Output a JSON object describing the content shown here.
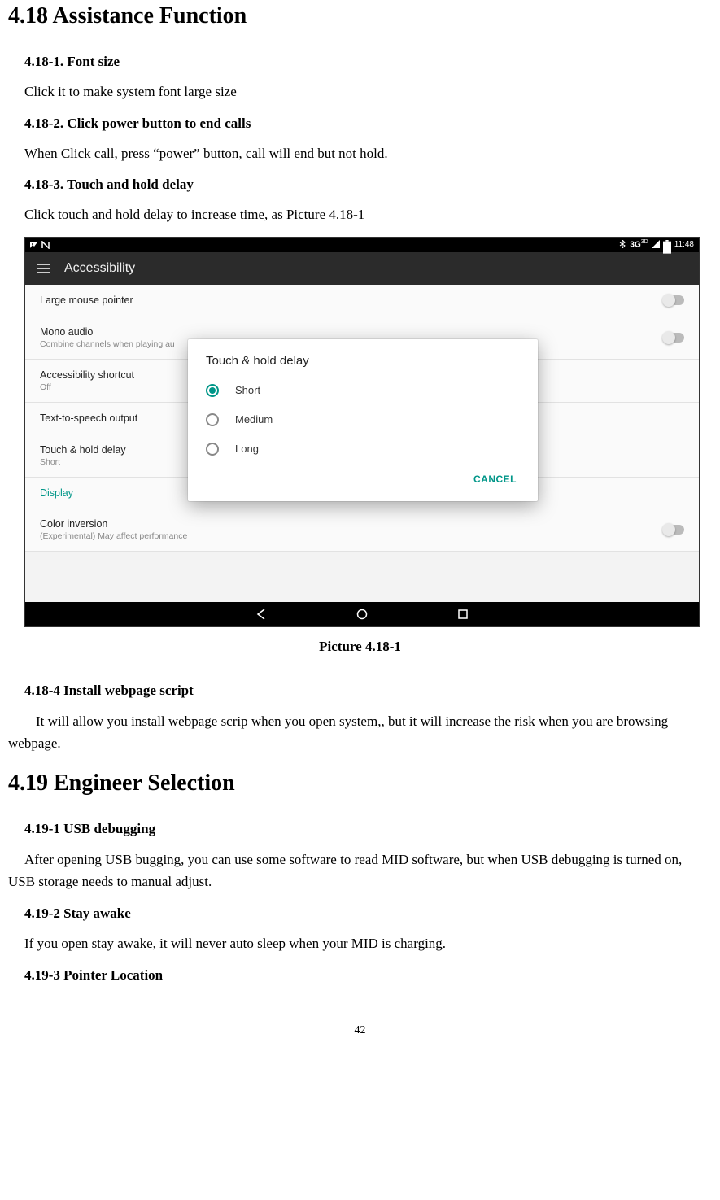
{
  "h2_1": "4.18    Assistance Function",
  "s418_1_h": "4.18-1. Font size",
  "s418_1_p": "Click it to make system font large size",
  "s418_2_h": "4.18-2. Click power button to end calls",
  "s418_2_p": "When Click call, press “power” button, call will end but not hold.",
  "s418_3_h": "4.18-3. Touch and hold delay",
  "s418_3_p": "Click touch and hold delay to increase time, as Picture 4.18-1",
  "caption1": "Picture 4.18-1",
  "s418_4_h": "4.18-4 Install webpage script",
  "s418_4_p": "It will allow you install webpage scrip when you open system,, but it will increase the risk when you are browsing webpage.",
  "h2_2": "4.19    Engineer Selection",
  "s419_1_h": "4.19-1 USB debugging",
  "s419_1_p": "After opening USB bugging, you can use some software to read MID software, but when USB debugging is turned on, USB storage needs to manual adjust.",
  "s419_2_h": "4.19-2 Stay awake",
  "s419_2_p": "If you open stay awake, it will never auto sleep when your MID is charging.",
  "s419_3_h": "4.19-3 Pointer Location",
  "page_number": "42",
  "screenshot": {
    "status": {
      "time": "11:48",
      "net": "3G"
    },
    "appbar_title": "Accessibility",
    "items": {
      "large_mouse": {
        "label": "Large mouse pointer"
      },
      "mono_audio": {
        "label": "Mono audio",
        "sub": "Combine channels when playing au"
      },
      "a11y_shortcut": {
        "label": "Accessibility shortcut",
        "sub": "Off"
      },
      "tts": {
        "label": "Text-to-speech output"
      },
      "touch_hold": {
        "label": "Touch & hold delay",
        "sub": "Short"
      },
      "display_header": {
        "label": "Display"
      },
      "color_inversion": {
        "label": "Color inversion",
        "sub": "(Experimental) May affect performance"
      }
    },
    "dialog": {
      "title": "Touch & hold delay",
      "opt_short": "Short",
      "opt_medium": "Medium",
      "opt_long": "Long",
      "cancel": "CANCEL"
    }
  }
}
